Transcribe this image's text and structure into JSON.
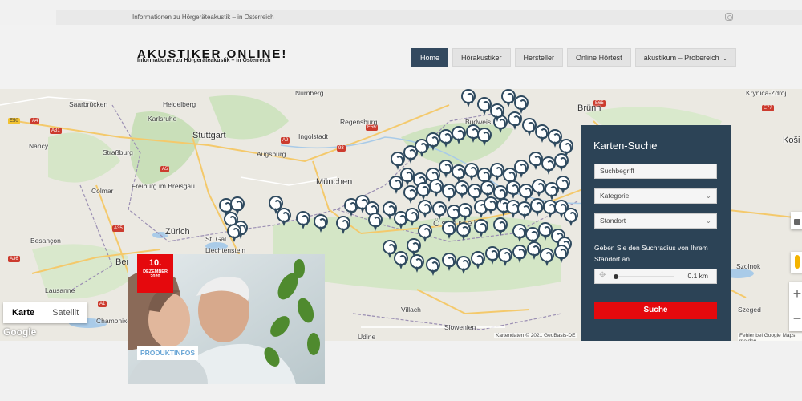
{
  "topbar": {
    "text": "Informationen zu Hörgeräteakustik – in Österreich",
    "icon": "instagram-icon"
  },
  "logo": {
    "title": "AKUSTIKER ONLINE!",
    "subtitle": "Informationen zu Hörgeräteakustik – in Österreich"
  },
  "nav": {
    "items": [
      {
        "label": "Home",
        "active": true
      },
      {
        "label": "Hörakustiker"
      },
      {
        "label": "Hersteller"
      },
      {
        "label": "Online Hörtest"
      },
      {
        "label": "akustikum – Probereich",
        "dropdown": true
      }
    ]
  },
  "map": {
    "labels": {
      "saarbruecken": "Saarbrücken",
      "heidelberg": "Heidelberg",
      "karlsruhe": "Karlsruhe",
      "stuttgart": "Stuttgart",
      "nancy": "Nancy",
      "strasbourg": "Straßburg",
      "freiburg": "Freiburg im Breisgau",
      "colmar": "Colmar",
      "besancon": "Besançon",
      "zurich": "Zürich",
      "stgallen": "St. Gal",
      "liechtenstein": "Liechtenstein",
      "bern": "Bern",
      "lausanne": "Lausanne",
      "chamonix": "Chamonix-Mont-Blanc",
      "nuernberg": "Nürnberg",
      "regensburg": "Regensburg",
      "ingolstadt": "Ingolstadt",
      "augsburg": "Augsburg",
      "muenchen": "München",
      "budweis": "Budweis",
      "bruenn": "Brünn",
      "oesterreich": "Österreich",
      "villach": "Villach",
      "slowenien": "Slowenien",
      "udine": "Udine",
      "krynica": "Krynica-Zdrój",
      "kosice": "Koši",
      "szolnok": "Szolnok",
      "szeged": "Szeged"
    },
    "map_type": {
      "map": "Karte",
      "satellite": "Satellit"
    },
    "google": "Google",
    "attribution": "Kartendaten © 2021 GeoBasis-DE",
    "error": "Fehler bei Google Maps melden"
  },
  "search": {
    "title": "Karten-Suche",
    "term_placeholder": "Suchbegriff",
    "category": "Kategorie",
    "location": "Standort",
    "radius_text": "Geben Sie den Suchradius von Ihrem Standort an",
    "radius_value": "0.1 km",
    "button": "Suche"
  },
  "card": {
    "day": "10.",
    "month": "DEZEMBER",
    "year": "2020",
    "tag": "PRODUKTINFOS"
  }
}
